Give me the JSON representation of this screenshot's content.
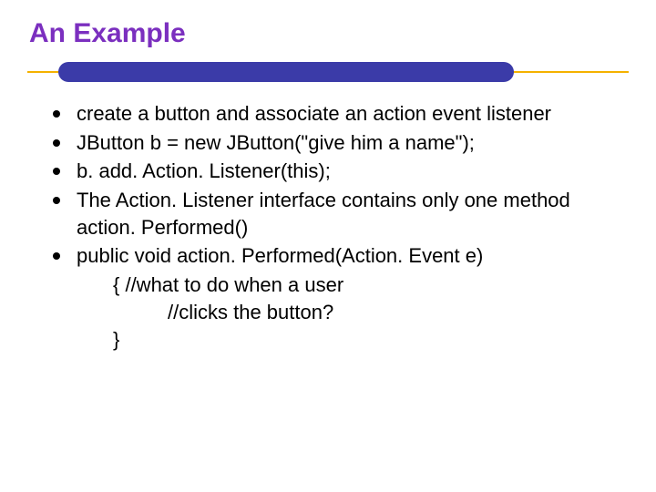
{
  "title": "An Example",
  "bullets": [
    "create a button and associate an action event listener",
    "JButton b = new JButton(\"give him a name\");",
    "b. add. Action. Listener(this);",
    "The Action. Listener interface contains only one method action. Performed()",
    "public void action. Performed(Action. Event e)"
  ],
  "code": {
    "line1": "{        //what to do when a user",
    "line2": "//clicks the button?",
    "line3": "}"
  }
}
